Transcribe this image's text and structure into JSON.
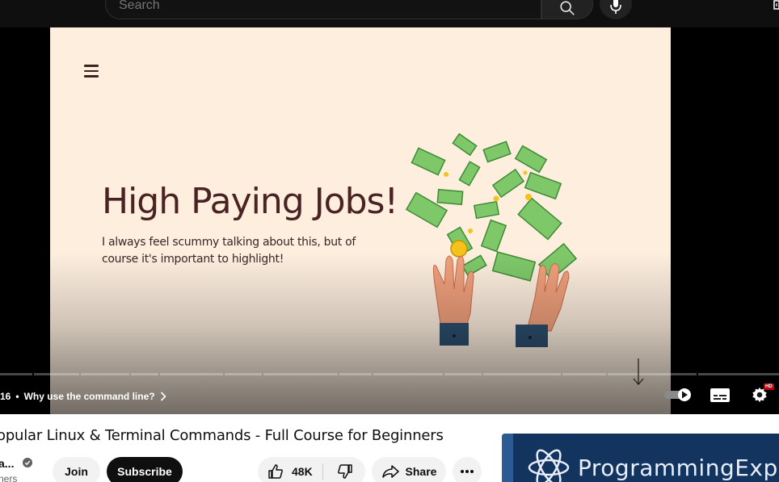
{
  "search": {
    "placeholder": "Search"
  },
  "slide": {
    "title": "High Paying Jobs!",
    "subtitle": "I always feel scummy talking about this, but of course it's important to highlight!"
  },
  "player": {
    "time": "16",
    "chapter_separator": "•",
    "chapter_title": "Why use the command line?",
    "hd_badge": "HD",
    "colors": {
      "slide_background": "#fdeede",
      "title_color": "#4a2224"
    }
  },
  "video": {
    "title": "opular Linux & Terminal Commands - Full Course for Beginners",
    "channel_name": "a...",
    "channel_subs": "ners"
  },
  "actions": {
    "join_label": "Join",
    "subscribe_label": "Subscribe",
    "like_count": "48K",
    "share_label": "Share"
  },
  "promo": {
    "text": "ProgrammingExpe"
  },
  "icons": [
    "search-icon",
    "mic-icon",
    "create-icon",
    "menu-icon",
    "chevron-right-icon",
    "autoplay-toggle",
    "subtitles-icon",
    "settings-icon",
    "verified-icon",
    "thumbs-up-icon",
    "thumbs-down-icon",
    "share-icon",
    "more-icon",
    "atom-logo-icon"
  ]
}
